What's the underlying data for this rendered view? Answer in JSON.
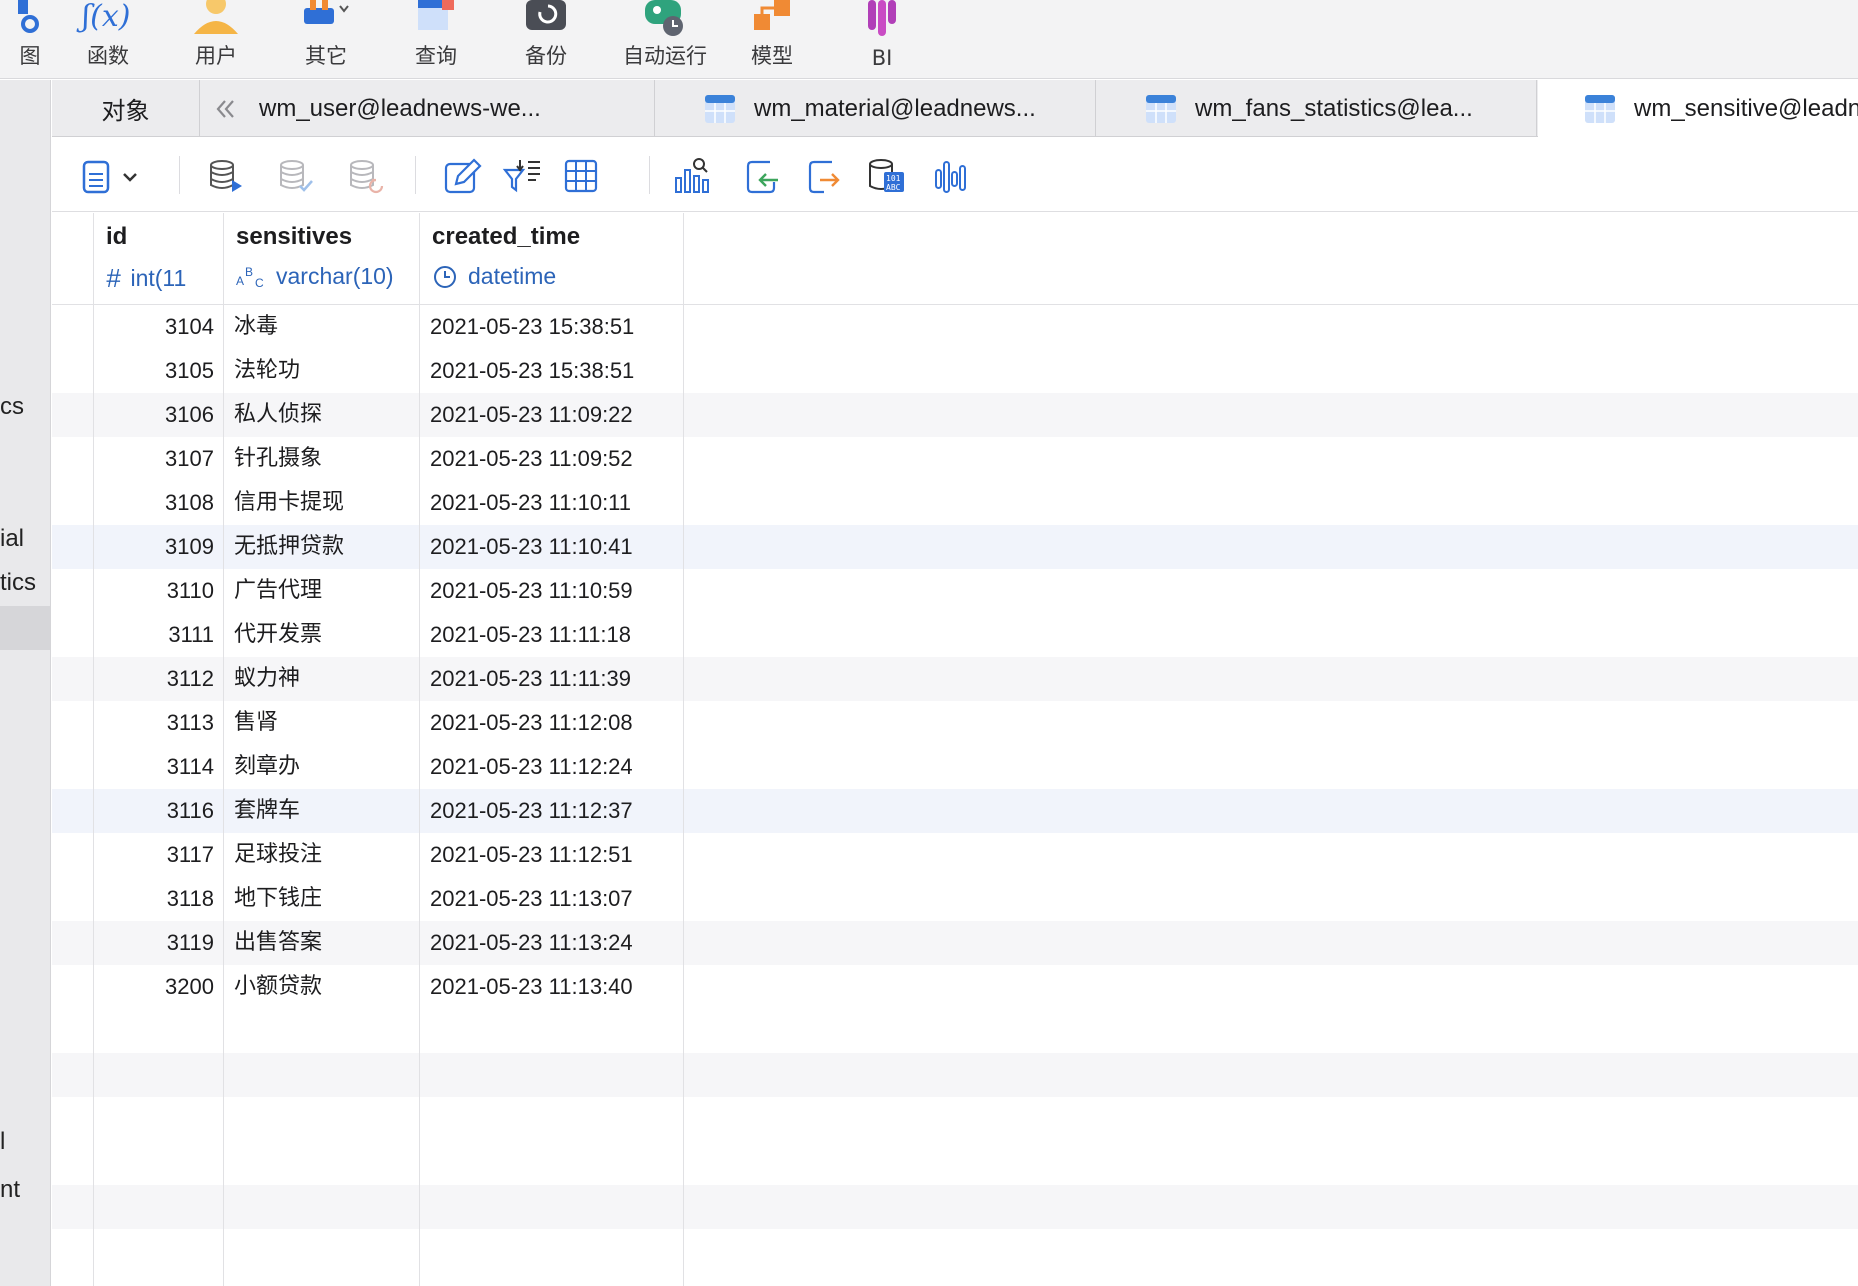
{
  "toolbar": {
    "items": [
      {
        "label": "图",
        "icon": "er-diagram-icon"
      },
      {
        "label": "函数",
        "icon": "function-icon"
      },
      {
        "label": "用户",
        "icon": "user-icon"
      },
      {
        "label": "其它",
        "icon": "other-icon"
      },
      {
        "label": "查询",
        "icon": "query-icon"
      },
      {
        "label": "备份",
        "icon": "backup-icon"
      },
      {
        "label": "自动运行",
        "icon": "automation-icon"
      },
      {
        "label": "模型",
        "icon": "model-icon"
      },
      {
        "label": "BI",
        "icon": "bi-icon"
      }
    ]
  },
  "sidebar": {
    "fragments": [
      "cs",
      "ial",
      "tics",
      "l",
      "nt"
    ]
  },
  "tabs": {
    "objects": "对象",
    "items": [
      {
        "label": "wm_user@leadnews-we...",
        "active": false
      },
      {
        "label": "wm_material@leadnews...",
        "active": false
      },
      {
        "label": "wm_fans_statistics@lea...",
        "active": false
      },
      {
        "label": "wm_sensitive@leadnews.",
        "active": true
      }
    ]
  },
  "actions": [
    "new-record-menu-icon",
    "begin-transaction-icon",
    "commit-icon",
    "rollback-icon",
    "edit-text-icon",
    "filter-sort-icon",
    "grid-view-icon",
    "chart-view-icon",
    "import-icon",
    "export-icon",
    "data-generation-icon",
    "profile-icon"
  ],
  "columns": [
    {
      "name": "id",
      "type": "int(11",
      "type_icon": "#"
    },
    {
      "name": "sensitives",
      "type": "varchar(10)",
      "type_icon": "ABC"
    },
    {
      "name": "created_time",
      "type": "datetime",
      "type_icon": "clock"
    }
  ],
  "rows": [
    {
      "id": "3104",
      "sensitives": "冰毒",
      "created_time": "2021-05-23 15:38:51"
    },
    {
      "id": "3105",
      "sensitives": "法轮功",
      "created_time": "2021-05-23 15:38:51"
    },
    {
      "id": "3106",
      "sensitives": "私人侦探",
      "created_time": "2021-05-23 11:09:22"
    },
    {
      "id": "3107",
      "sensitives": "针孔摄象",
      "created_time": "2021-05-23 11:09:52"
    },
    {
      "id": "3108",
      "sensitives": "信用卡提现",
      "created_time": "2021-05-23 11:10:11"
    },
    {
      "id": "3109",
      "sensitives": "无抵押贷款",
      "created_time": "2021-05-23 11:10:41"
    },
    {
      "id": "3110",
      "sensitives": "广告代理",
      "created_time": "2021-05-23 11:10:59"
    },
    {
      "id": "3111",
      "sensitives": "代开发票",
      "created_time": "2021-05-23 11:11:18"
    },
    {
      "id": "3112",
      "sensitives": "蚁力神",
      "created_time": "2021-05-23 11:11:39"
    },
    {
      "id": "3113",
      "sensitives": "售肾",
      "created_time": "2021-05-23 11:12:08"
    },
    {
      "id": "3114",
      "sensitives": "刻章办",
      "created_time": "2021-05-23 11:12:24"
    },
    {
      "id": "3116",
      "sensitives": "套牌车",
      "created_time": "2021-05-23 11:12:37"
    },
    {
      "id": "3117",
      "sensitives": "足球投注",
      "created_time": "2021-05-23 11:12:51"
    },
    {
      "id": "3118",
      "sensitives": "地下钱庄",
      "created_time": "2021-05-23 11:13:07"
    },
    {
      "id": "3119",
      "sensitives": "出售答案",
      "created_time": "2021-05-23 11:13:24"
    },
    {
      "id": "3200",
      "sensitives": "小额贷款",
      "created_time": "2021-05-23 11:13:40"
    }
  ],
  "colors": {
    "accent": "#2c64b8",
    "tab_icon": "#3b82d9",
    "chart_icon": "#1f6fd1"
  }
}
